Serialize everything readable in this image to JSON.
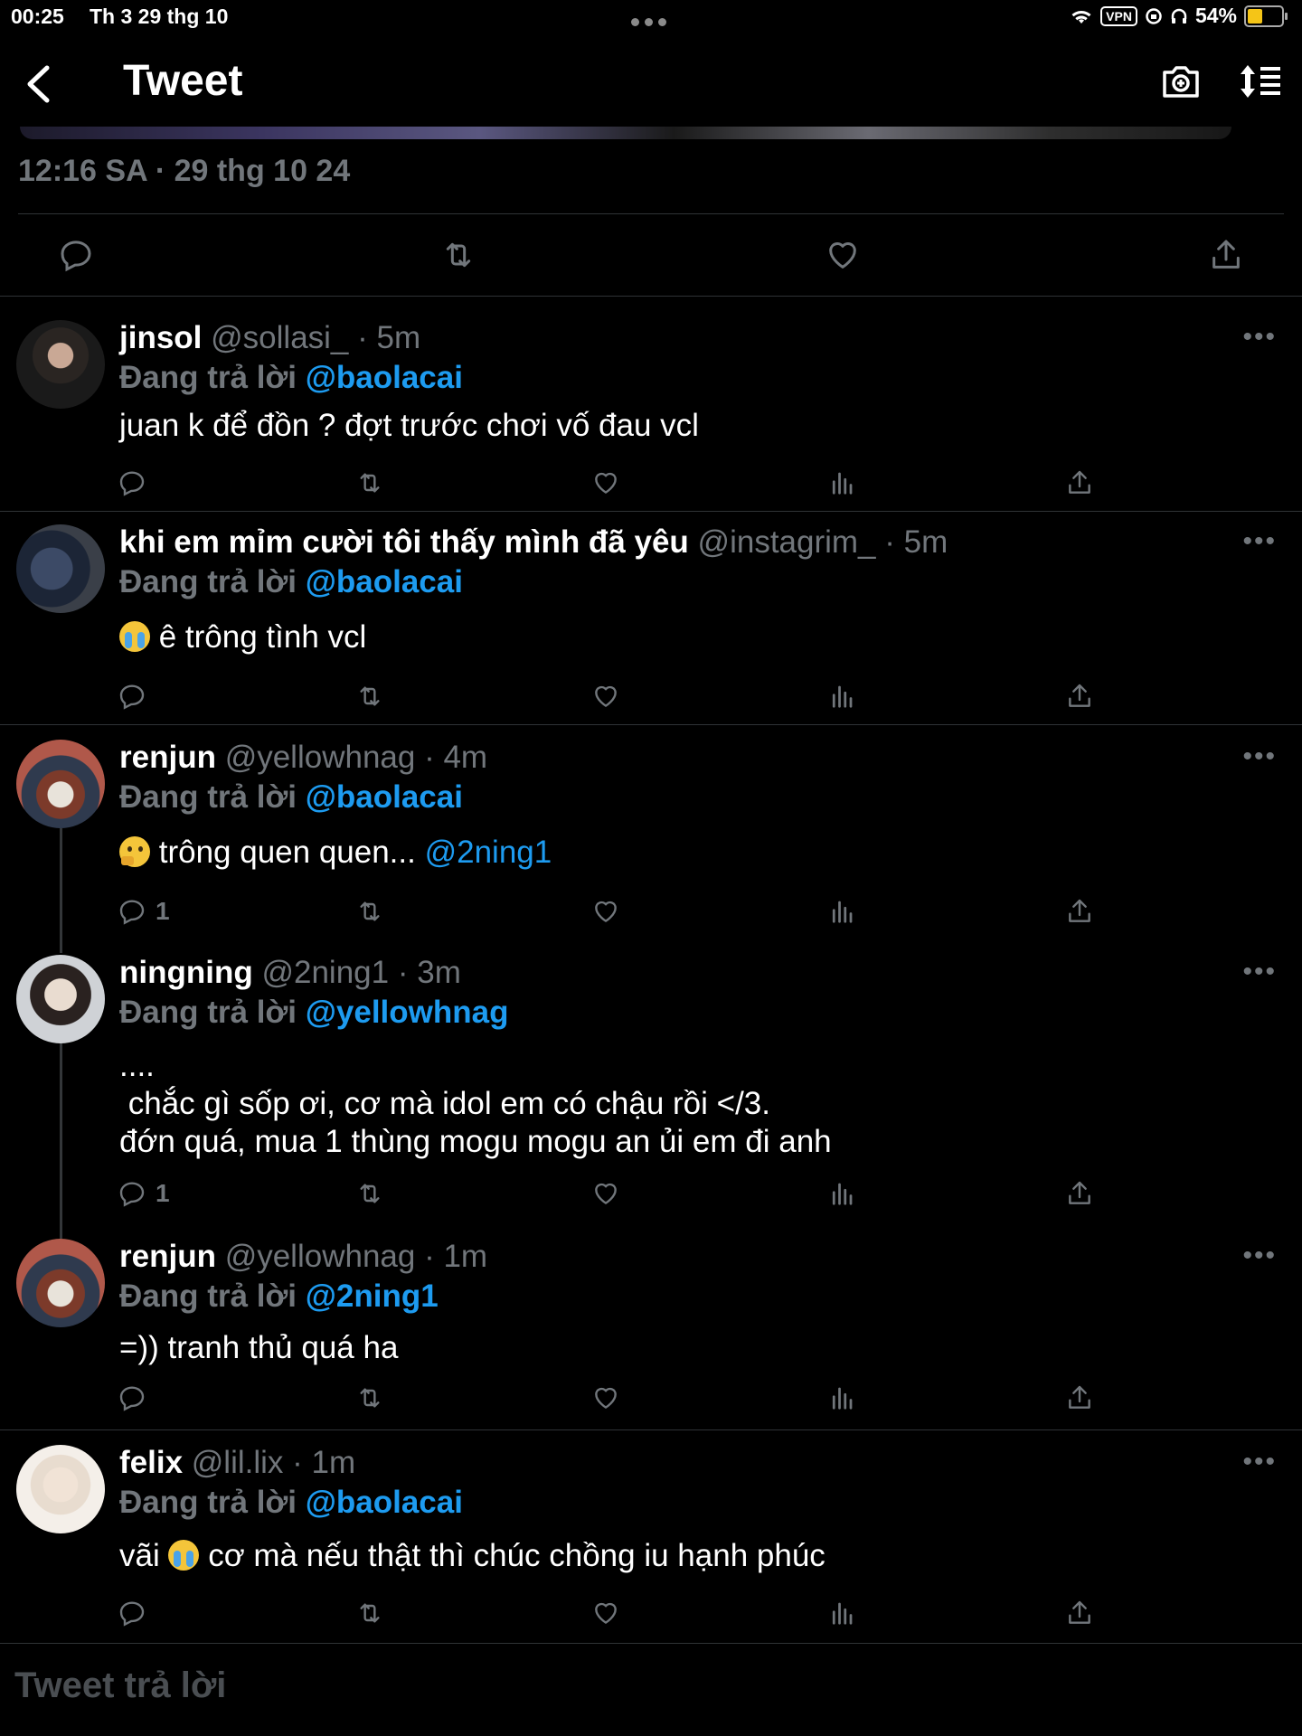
{
  "status_bar": {
    "time": "00:25",
    "date": "Th 3 29 thg 10",
    "vpn": "VPN",
    "battery": "54%",
    "battery_level": 0.54
  },
  "header": {
    "title": "Tweet"
  },
  "main_tweet": {
    "timestamp": "12:16 SA · 29 thg 10 24"
  },
  "reply_prefix": "Đang trả lời",
  "tweets": [
    {
      "name": "jinsol",
      "handle": "@sollasi_",
      "time": "· 5m",
      "reply_to": "@baolacai",
      "text": "juan k để đồn ? đợt trước chơi vố đau vcl",
      "reply_count": ""
    },
    {
      "name": "khi em mỉm cười tôi thấy mình đã yêu",
      "handle": "@instagrim_",
      "time": "· 5m",
      "reply_to": "@baolacai",
      "emoji": "loudly-crying-face",
      "text": "ê trông tình vcl",
      "reply_count": ""
    },
    {
      "name": "renjun",
      "handle": "@yellowhnag",
      "time": "· 4m",
      "reply_to": "@baolacai",
      "emoji": "thinking-face",
      "text": "trông quen quen...",
      "text_mention": "@2ning1",
      "reply_count": "1"
    },
    {
      "name": "ningning",
      "handle": "@2ning1",
      "time": "· 3m",
      "reply_to": "@yellowhnag",
      "text": "....\n chắc gì sốp ơi, cơ mà idol em có chậu rồi </3.\nđớn quá, mua 1 thùng mogu mogu an ủi em đi anh",
      "reply_count": "1"
    },
    {
      "name": "renjun",
      "handle": "@yellowhnag",
      "time": "· 1m",
      "reply_to": "@2ning1",
      "text": "=)) tranh thủ quá ha",
      "reply_count": ""
    },
    {
      "name": "felix",
      "handle": "@lil.lix",
      "time": "· 1m",
      "reply_to": "@baolacai",
      "text_before": "vãi",
      "emoji": "loudly-crying-face",
      "text": "cơ mà nếu thật thì chúc chồng iu hạnh phúc",
      "reply_count": ""
    }
  ],
  "composer": {
    "placeholder": "Tweet trả lời"
  },
  "colors": {
    "accent": "#1d9bf0",
    "muted": "#71767b",
    "background": "#000000"
  }
}
